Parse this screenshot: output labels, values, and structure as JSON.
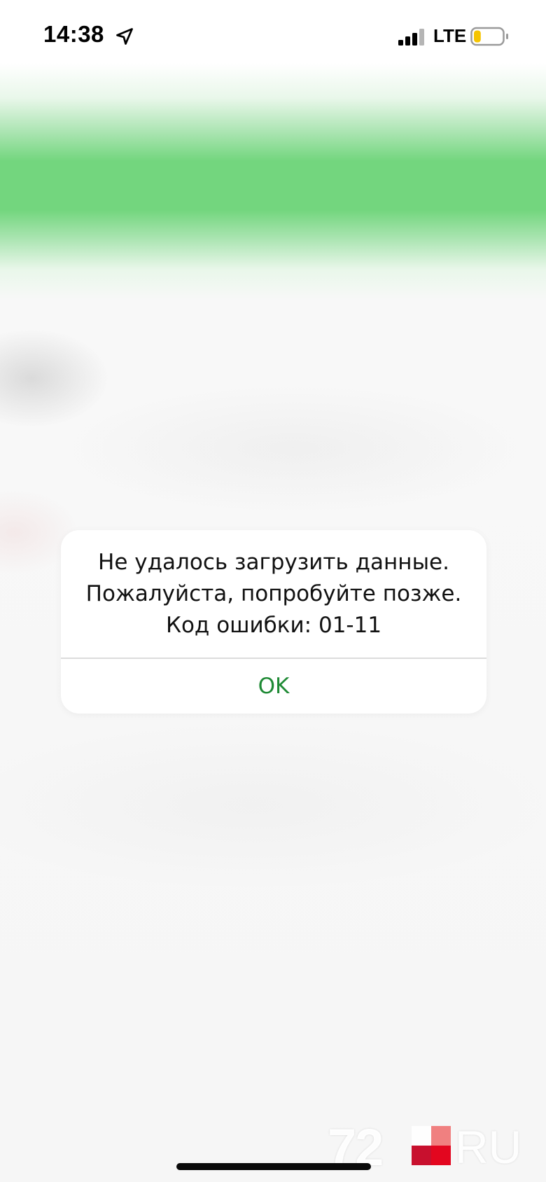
{
  "status_bar": {
    "time": "14:38",
    "network": "LTE",
    "icons": {
      "location": "location-arrow-icon",
      "signal": "cellular-signal-icon",
      "battery": "battery-low-icon"
    },
    "battery_level": 0.25,
    "battery_color": "#f5c400"
  },
  "alert": {
    "message_lines": [
      "Не удалось загрузить данные.",
      "Пожалуйста, попробуйте позже.",
      "Код ошибки: 01-11"
    ],
    "button_label": "OK",
    "button_color": "#1f8a35"
  },
  "watermark": {
    "number": "72",
    "suffix": "RU",
    "logo_color": "#e3061f"
  },
  "colors": {
    "header_green": "#73d67e"
  }
}
